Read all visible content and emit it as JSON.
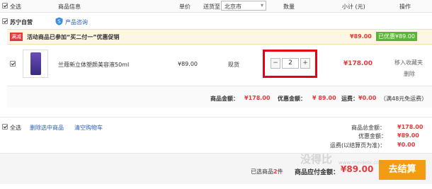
{
  "header": {
    "select_all": "全选",
    "product_info": "商品信息",
    "unit_price": "单价",
    "ship_to": "送货至",
    "city": "北京市",
    "quantity": "数量",
    "subtotal": "小计 (元)",
    "actions": "操作"
  },
  "store": {
    "name": "苏宁自营",
    "consult": "产品咨询"
  },
  "promo": {
    "badge": "满减",
    "text": "活动商品已参加“买二付一”优惠促销",
    "price": "¥89.00",
    "discount_badge": "已优惠¥89.00"
  },
  "item": {
    "name": "兰蔻新立体塑颜美容液50ml",
    "unit_price": "¥89.00",
    "stock": "现货",
    "qty": "2",
    "minus": "−",
    "plus": "+",
    "subtotal": "¥178.00",
    "move_fav": "移入收藏夹",
    "delete": "删除"
  },
  "store_summary": {
    "goods_label": "商品金额：",
    "goods_value": "¥178.00",
    "discount_label": "优惠金额：",
    "discount_value": "¥ 89.00",
    "shipping_label": "运费：",
    "shipping_value": "¥0.00",
    "shipping_note": "（满48元免运费）"
  },
  "footer": {
    "select_all": "全选",
    "delete_selected": "删除选中商品",
    "clear_cart": "清空购物车",
    "total_label": "商品总金额：",
    "total_value": "¥178.00",
    "discount_label": "优惠金额：",
    "discount_value": "¥89.00",
    "shipping_label": "运费(以结算页为准)：",
    "shipping_value": "¥0.00",
    "selected_prefix": "已选商品",
    "selected_count": "2",
    "selected_suffix": "件",
    "payable_label": "商品应付金额：",
    "payable_value": "¥89.00",
    "checkout": "去结算"
  },
  "watermark": {
    "brand": "没得比",
    "url": "www.meidebi.com"
  },
  "colors": {
    "accent_red": "#e4393c",
    "checkout_orange": "#f39c12",
    "promo_bg": "#fdf6e3",
    "discount_green": "#5ab534",
    "highlight_box": "#e60012"
  }
}
